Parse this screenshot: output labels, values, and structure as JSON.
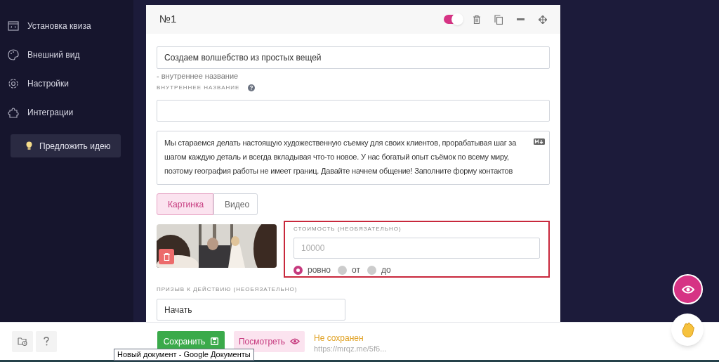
{
  "sidebar": {
    "items": [
      {
        "label": "Установка квиза"
      },
      {
        "label": "Внешний вид"
      },
      {
        "label": "Настройки"
      },
      {
        "label": "Интеграции"
      }
    ],
    "idea_button": "Предложить идею"
  },
  "card": {
    "title": "№1",
    "enabled": true,
    "name_field": {
      "value": "Создаем волшебство из простых вещей"
    },
    "name_note": "- внутреннее название",
    "internal_label": "ВНУТРЕННЕЕ НАЗВАНИЕ",
    "description": "Мы стараемся делать настоящую художественную съемку для своих клиентов, прорабатывая шаг за шагом каждую деталь и всегда вкладывая что-то новое. У нас богатый опыт съёмок по всему миру, поэтому география работы не имеет границ. Давайте начнем общение! Заполните форму контактов",
    "media_tabs": [
      {
        "label": "Картинка",
        "selected": true
      },
      {
        "label": "Видео",
        "selected": false
      }
    ],
    "price": {
      "label": "СТОИМОСТЬ (НЕОБЯЗАТЕЛЬНО)",
      "placeholder": "10000",
      "options": [
        {
          "label": "ровно",
          "selected": true
        },
        {
          "label": "от",
          "selected": false
        },
        {
          "label": "до",
          "selected": false
        }
      ]
    },
    "cta": {
      "label": "ПРИЗЫВ К ДЕЙСТВИЮ (НЕОБЯЗАТЕЛЬНО)",
      "value": "Начать"
    }
  },
  "footer": {
    "save_button": "Сохранить",
    "preview_button": "Посмотреть",
    "status": "Не сохранен",
    "link": "https://mrqz.me/5f6..."
  },
  "tooltip": "Новый документ - Google Документы"
}
